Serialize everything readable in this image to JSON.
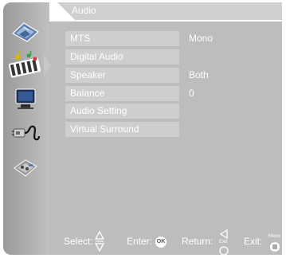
{
  "menu": {
    "title": "Audio",
    "items": [
      {
        "label": "MTS",
        "value": "Mono"
      },
      {
        "label": "Digital Audio",
        "value": ""
      },
      {
        "label": "Speaker",
        "value": "Both"
      },
      {
        "label": "Balance",
        "value": "0"
      },
      {
        "label": "Audio Setting",
        "value": ""
      },
      {
        "label": "Virtual Surround",
        "value": ""
      }
    ]
  },
  "sidebar": {
    "icons": [
      "picture-icon",
      "audio-icon",
      "tv-channel-icon",
      "setup-icon",
      "lock-icon"
    ],
    "active": "audio-icon"
  },
  "footer": {
    "select_label": "Select:",
    "enter_label": "Enter:",
    "enter_key": "OK",
    "return_label": "Return:",
    "return_key": "Exit",
    "exit_label": "Exit:",
    "exit_key": "Menu"
  },
  "colors": {
    "panel": "#bdbdbd",
    "row": "#cecece",
    "sidebar": "#a8a8a8",
    "text": "#ffffff"
  }
}
